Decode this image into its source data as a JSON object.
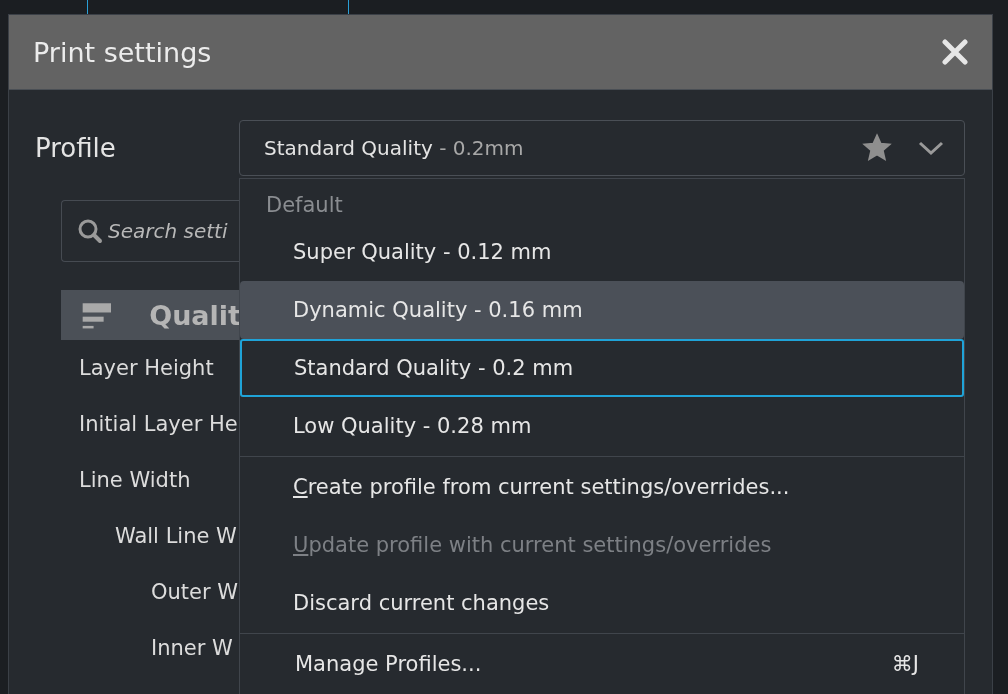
{
  "window": {
    "title": "Print settings"
  },
  "profile": {
    "label": "Profile",
    "name": "Standard Quality",
    "suffix": " - 0.2mm",
    "favorite": true
  },
  "search": {
    "placeholder": "Search setti"
  },
  "category": {
    "label": "Qualit"
  },
  "settings": [
    {
      "label": "Layer Height"
    },
    {
      "label": "Initial Layer He"
    },
    {
      "label": "Line Width",
      "children": [
        {
          "label": "Wall Line W",
          "children": [
            {
              "label": "Outer W"
            },
            {
              "label": "Inner W"
            }
          ]
        }
      ]
    }
  ],
  "dropdown": {
    "header": "Default",
    "profiles": [
      {
        "label": "Super Quality - 0.12 mm",
        "hovered": false,
        "selected": false
      },
      {
        "label": "Dynamic Quality - 0.16 mm",
        "hovered": true,
        "selected": false
      },
      {
        "label": "Standard Quality - 0.2 mm",
        "hovered": false,
        "selected": true
      },
      {
        "label": "Low Quality - 0.28 mm",
        "hovered": false,
        "selected": false
      }
    ],
    "actions": [
      {
        "label": "Create profile from current settings/overrides...",
        "mnemonic": true,
        "disabled": false
      },
      {
        "label": "Update profile with current settings/overrides",
        "mnemonic": true,
        "disabled": true
      },
      {
        "label": "Discard current changes",
        "mnemonic": false,
        "disabled": false
      }
    ],
    "manage": {
      "label": "Manage Profiles...",
      "shortcut": "⌘J"
    }
  }
}
